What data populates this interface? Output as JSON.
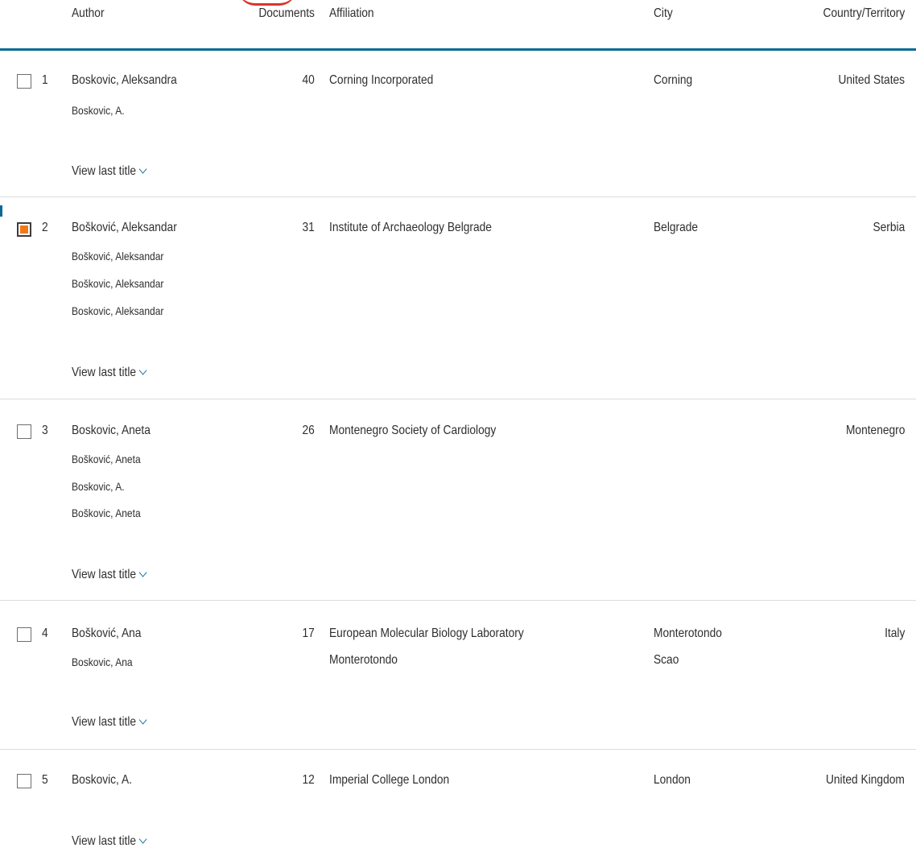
{
  "header": {
    "author": "Author",
    "documents": "Documents",
    "affiliation": "Affiliation",
    "city": "City",
    "country": "Country/Territory"
  },
  "rows": [
    {
      "index": "1",
      "checked": false,
      "name": "Boskovic, Aleksandra",
      "variants": [
        "Boskovic, A."
      ],
      "documents": "40",
      "affiliation": [
        "Corning Incorporated"
      ],
      "city": [
        "Corning"
      ],
      "country": "United States",
      "view_last": "View last title"
    },
    {
      "index": "2",
      "checked": true,
      "name": "Bošković, Aleksandar",
      "variants": [
        "Bošković, Aleksandar",
        "Boškovic, Aleksandar",
        "Boskovic, Aleksandar"
      ],
      "documents": "31",
      "affiliation": [
        "Institute of Archaeology Belgrade"
      ],
      "city": [
        "Belgrade"
      ],
      "country": "Serbia",
      "view_last": "View last title"
    },
    {
      "index": "3",
      "checked": false,
      "name": "Boskovic, Aneta",
      "variants": [
        "Bošković, Aneta",
        "Boskovic, A.",
        "Boškovic, Aneta"
      ],
      "documents": "26",
      "affiliation": [
        "Montenegro Society of Cardiology"
      ],
      "city": [],
      "country": "Montenegro",
      "view_last": "View last title"
    },
    {
      "index": "4",
      "checked": false,
      "name": "Bošković, Ana",
      "variants": [
        "Boskovic, Ana"
      ],
      "documents": "17",
      "affiliation": [
        "European Molecular Biology Laboratory",
        "Monterotondo"
      ],
      "city": [
        "Monterotondo",
        "Scao"
      ],
      "country": "Italy",
      "view_last": "View last title"
    },
    {
      "index": "5",
      "checked": false,
      "name": "Boskovic, A.",
      "variants": [],
      "documents": "12",
      "affiliation": [
        "Imperial College London"
      ],
      "city": [
        "London"
      ],
      "country": "United Kingdom",
      "view_last": "View last title"
    }
  ],
  "colors": {
    "accent": "#0a6a96",
    "checkbox_fill": "#f07a1a",
    "divider": "#dcdcdc",
    "text": "#2e2e2e"
  }
}
